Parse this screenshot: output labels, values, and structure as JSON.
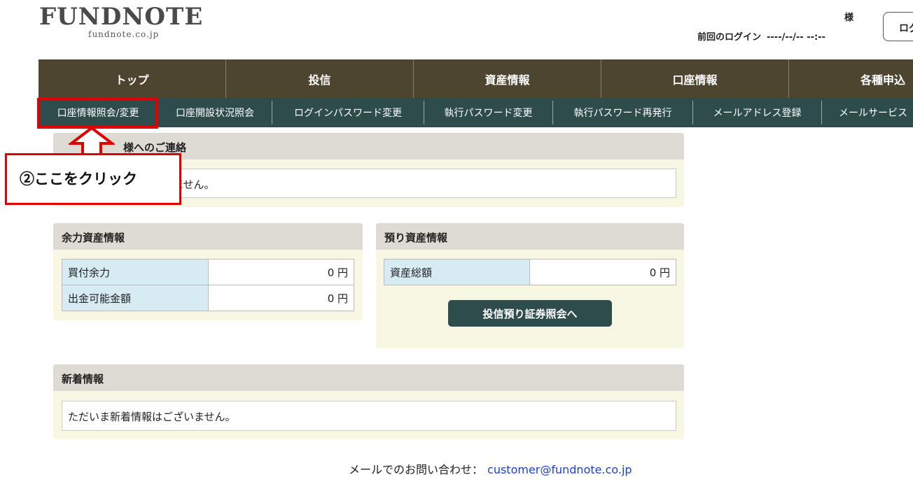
{
  "header": {
    "logo": "FUNDNOTE",
    "logo_sub": "fundnote.co.jp",
    "honorific": "様",
    "last_login_label": "前回のログイン",
    "last_login_value": "----/--/-- --:--",
    "logout_label": "ログ"
  },
  "main_nav": [
    {
      "label": "トップ"
    },
    {
      "label": "投信"
    },
    {
      "label": "資産情報"
    },
    {
      "label": "口座情報"
    },
    {
      "label": "各種申込"
    }
  ],
  "sub_nav": [
    {
      "label": "口座情報照会/変更"
    },
    {
      "label": "口座開設状況照会"
    },
    {
      "label": "ログインパスワード変更"
    },
    {
      "label": "執行パスワード変更"
    },
    {
      "label": "執行パスワード再発行"
    },
    {
      "label": "メールアドレス登録"
    },
    {
      "label": "メールサービス"
    }
  ],
  "notice": {
    "title": "様へのご連絡",
    "message": "ただいま連絡はございません。"
  },
  "buying_power": {
    "title": "余力資産情報",
    "rows": [
      {
        "label": "買付余力",
        "value": "0 円"
      },
      {
        "label": "出金可能金額",
        "value": "0 円"
      }
    ]
  },
  "holdings": {
    "title": "預り資産情報",
    "rows": [
      {
        "label": "資産総額",
        "value": "0 円"
      }
    ],
    "button_label": "投信預り証券照会へ"
  },
  "news": {
    "title": "新着情報",
    "message": "ただいま新着情報はございません。"
  },
  "footer": {
    "label": "メールでのお問い合わせ：",
    "email": "customer@fundnote.co.jp"
  },
  "annotation": {
    "callout": "②ここをクリック",
    "color": "#e10000"
  }
}
